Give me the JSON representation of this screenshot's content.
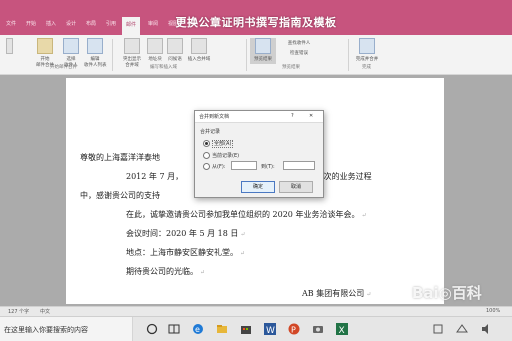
{
  "caption": "更换公章证明书撰写指南及模板",
  "ribbon_tabs": [
    "文件",
    "开始",
    "插入",
    "设计",
    "布局",
    "引用",
    "邮件",
    "审阅",
    "视图",
    "帮助"
  ],
  "ribbon": {
    "buttons": [
      {
        "label": "开始\n邮件合并"
      },
      {
        "label": "选择\n收件人"
      },
      {
        "label": "编辑\n收件人列表"
      },
      {
        "label": "突出显示\n合并域"
      },
      {
        "label": "地址块"
      },
      {
        "label": "问候语"
      },
      {
        "label": "插入合并域"
      },
      {
        "label": "预览结果"
      },
      {
        "label": "查找收件人"
      },
      {
        "label": "检查错误"
      },
      {
        "label": "完成并合并"
      }
    ],
    "groups": [
      "开始邮件合并",
      "编写和插入域",
      "预览结果",
      "完成"
    ]
  },
  "document": {
    "salutation": "尊敬的上海嘉洋洋泰地",
    "para1_start": "2012 年 7 月，",
    "para1_end": "0 次的业务过程",
    "para1_cont": "中，感谢贵公司的支持",
    "invite": "在此，诚挚邀请贵公司参加我单位组织的 2020 年业务洽谈年会。",
    "meeting_time": "会议时间：2020 年 5 月 18 日",
    "location": "地点：上海市静安区静安礼堂。",
    "closing": "期待贵公司的光临。",
    "signature": "AB 集团有限公司",
    "para_mark": "↵"
  },
  "dialog": {
    "title": "合并到新文档",
    "help": "?",
    "close": "✕",
    "section_label": "合并记录",
    "options": [
      {
        "label": "全部(A)",
        "selected": true
      },
      {
        "label": "当前记录(E)",
        "selected": false
      },
      {
        "label": "从(F):",
        "selected": false
      }
    ],
    "to_label": "到(T):",
    "ok": "确定",
    "cancel": "取消"
  },
  "statusbar": {
    "page_info": "127 个字",
    "lang": "中文",
    "zoom": "100%"
  },
  "taskbar": {
    "search_placeholder": "在这里输入你要搜索的内容"
  },
  "watermark": "Bai◎百科",
  "colors": {
    "accent": "#c7547e",
    "ribbon_bg": "#f3f3f3",
    "dialog_bg": "#f1f1f1"
  }
}
